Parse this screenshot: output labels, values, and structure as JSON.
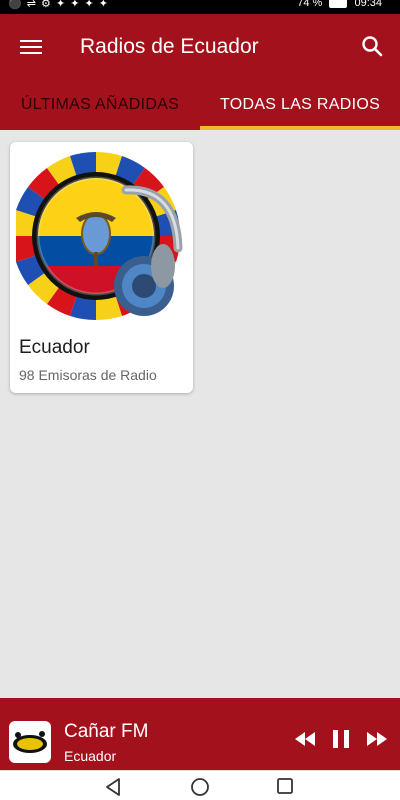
{
  "status_bar": {
    "left_icons": "⚫ ⇌ ⚙ ✦ ✦ ✦ ✦",
    "battery": "74 %",
    "time": "09:34"
  },
  "app_bar": {
    "title": "Radios de Ecuador",
    "menu_icon": "menu-icon",
    "search_icon": "search-icon"
  },
  "tabs": [
    {
      "label": "ÚLTIMAS AÑADIDAS",
      "selected": false
    },
    {
      "label": "TODAS LAS RADIOS",
      "selected": true
    }
  ],
  "colors": {
    "primary": "#a3111c",
    "tab_indicator": "#f2b632",
    "background": "#e6e6e6"
  },
  "cards": [
    {
      "title": "Ecuador",
      "subtitle": "98 Emisoras de Radio",
      "image": "ecuador-flag-headphones-logo"
    }
  ],
  "player": {
    "title": "Cañar FM",
    "subtitle": "Ecuador",
    "logo_text": "CAÑAR",
    "controls": [
      "rewind-icon",
      "pause-icon",
      "fast-forward-icon"
    ]
  },
  "nav_bar": {
    "buttons": [
      "back-icon",
      "home-icon",
      "recent-apps-icon"
    ]
  }
}
